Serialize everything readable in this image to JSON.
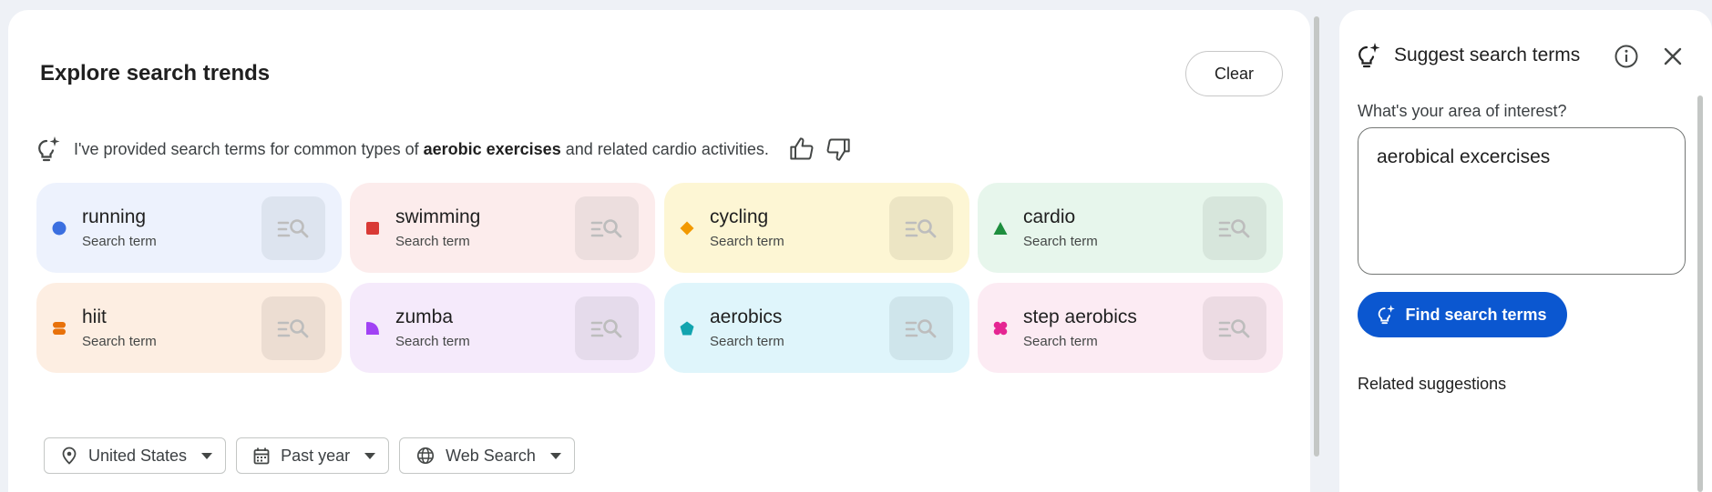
{
  "main": {
    "title": "Explore search trends",
    "clear_label": "Clear",
    "ai_message": {
      "prefix": "I've provided search terms for common types of ",
      "bold": "aerobic exercises",
      "suffix": " and related cardio activities."
    },
    "cards": [
      {
        "name": "running",
        "sub": "Search term",
        "color": "#3b6fe0",
        "bg": "#edf2fd",
        "tile": "#dde4ef",
        "shape": "circle"
      },
      {
        "name": "swimming",
        "sub": "Search term",
        "color": "#d93a36",
        "bg": "#fcecec",
        "tile": "#ecdede",
        "shape": "square"
      },
      {
        "name": "cycling",
        "sub": "Search term",
        "color": "#f29900",
        "bg": "#fdf6d4",
        "tile": "#ece5c4",
        "shape": "diamond"
      },
      {
        "name": "cardio",
        "sub": "Search term",
        "color": "#1e8e3e",
        "bg": "#e7f6ec",
        "tile": "#d7e6dc",
        "shape": "triangle"
      },
      {
        "name": "hiit",
        "sub": "Search term",
        "color": "#e8710a",
        "bg": "#fdeee2",
        "tile": "#ecddd2",
        "shape": "pill"
      },
      {
        "name": "zumba",
        "sub": "Search term",
        "color": "#a142f4",
        "bg": "#f5eafb",
        "tile": "#e5dbeb",
        "shape": "quarter"
      },
      {
        "name": "aerobics",
        "sub": "Search term",
        "color": "#12a4af",
        "bg": "#dff5fb",
        "tile": "#cfe5eb",
        "shape": "pentagon"
      },
      {
        "name": "step aerobics",
        "sub": "Search term",
        "color": "#e52592",
        "bg": "#fcebf3",
        "tile": "#ecdbe3",
        "shape": "flower"
      }
    ],
    "filters": [
      {
        "label": "United States",
        "icon": "location-pin-icon"
      },
      {
        "label": "Past year",
        "icon": "calendar-icon"
      },
      {
        "label": "Web Search",
        "icon": "globe-icon"
      }
    ]
  },
  "side": {
    "title": "Suggest search terms",
    "interest_label": "What's your area of interest?",
    "interest_value": "aerobical excercises",
    "find_label": "Find search terms",
    "related_label": "Related suggestions",
    "accent": "#0b57d0"
  }
}
